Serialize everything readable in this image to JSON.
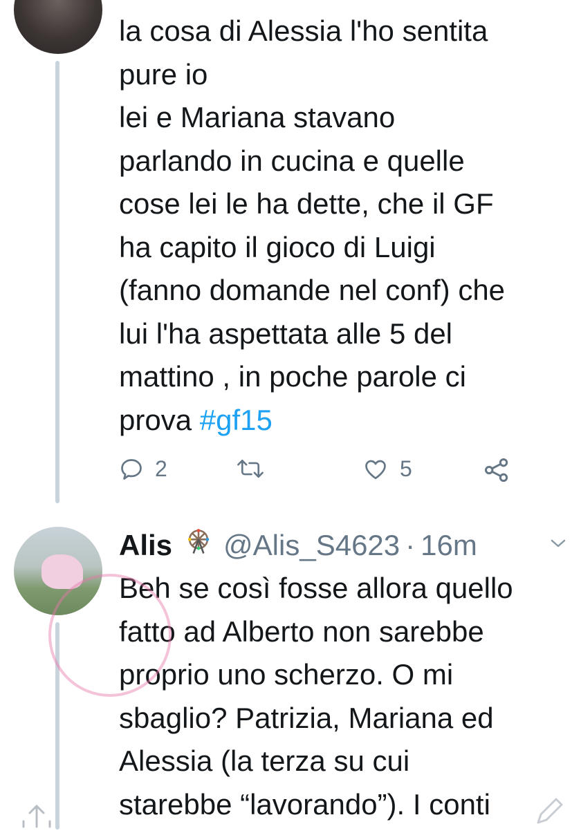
{
  "tweet": {
    "text_lines": [
      "la cosa di Alessia l'ho sentita",
      "pure io",
      "lei e Mariana stavano",
      "parlando in cucina e quelle",
      "cose lei le ha dette, che il GF",
      "ha capito il gioco di Luigi",
      "(fanno domande nel conf) che",
      "lui l'ha aspettata alle 5 del",
      "mattino , in poche parole ci",
      "prova "
    ],
    "hashtag": "#gf15",
    "actions": {
      "reply_count": "2",
      "like_count": "5",
      "icons": [
        "reply-icon",
        "retweet-icon",
        "like-icon",
        "share-icon"
      ]
    }
  },
  "reply": {
    "name": "Alis",
    "handle": "@Alis_S4623",
    "separator": "·",
    "time": "16m",
    "text_lines": [
      "Beh se così fosse allora quello",
      "fatto ad Alberto non sarebbe",
      "proprio uno scherzo. O mi",
      "sbaglio? Patrizia, Mariana ed",
      "Alessia (la terza su cui",
      "starebbe “lavorando”). I conti"
    ]
  },
  "colors": {
    "text": "#14171a",
    "muted": "#657786",
    "link": "#1da1f2",
    "thread_line": "#c9d3dc"
  }
}
